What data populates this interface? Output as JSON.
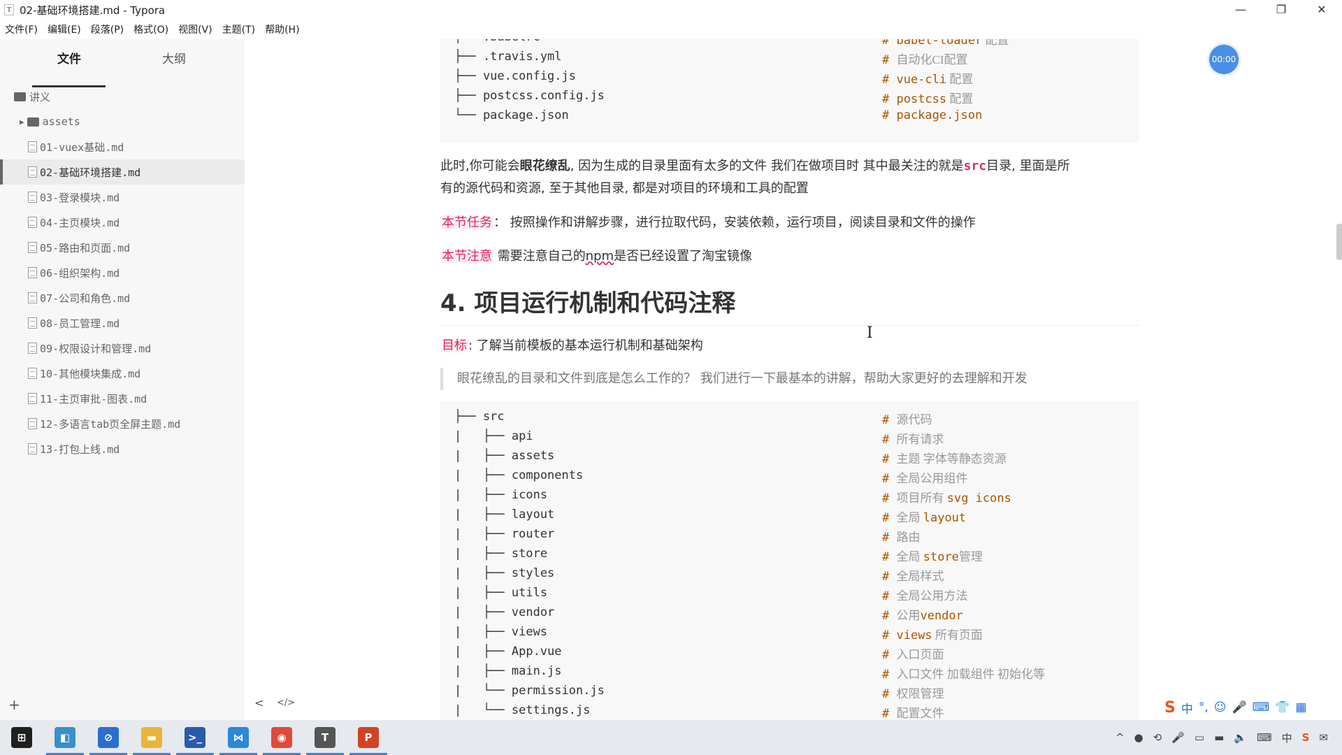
{
  "window": {
    "title": "02-基础环境搭建.md - Typora",
    "app_icon": "T",
    "controls": {
      "minimize": "—",
      "restore": "❐",
      "close": "✕"
    }
  },
  "menu": [
    "文件(F)",
    "编辑(E)",
    "段落(P)",
    "格式(O)",
    "视图(V)",
    "主题(T)",
    "帮助(H)"
  ],
  "sidebar": {
    "tabs": {
      "files": "文件",
      "outline": "大纲"
    },
    "root_folder": "讲义",
    "subfolder": "assets",
    "files": [
      "01-vuex基础.md",
      "02-基础环境搭建.md",
      "03-登录模块.md",
      "04-主页模块.md",
      "05-路由和页面.md",
      "06-组织架构.md",
      "07-公司和角色.md",
      "08-员工管理.md",
      "09-权限设计和管理.md",
      "10-其他模块集成.md",
      "11-主页审批-图表.md",
      "12-多语言tab页全屏主题.md",
      "13-打包上线.md"
    ],
    "active_index": 1,
    "add_button": "+",
    "collapse_button": "<",
    "source_button": "</>"
  },
  "top_code": [
    {
      "tree": "├── .babelrc",
      "kw": "babel-loader",
      "cn": " 配置"
    },
    {
      "tree": "├── .travis.yml",
      "kw": "",
      "cn": "自动化CI配置"
    },
    {
      "tree": "├── vue.config.js",
      "kw": "vue-cli",
      "cn": " 配置"
    },
    {
      "tree": "├── postcss.config.js",
      "kw": "postcss",
      "cn": " 配置"
    },
    {
      "tree": "└── package.json",
      "kw": "package.json",
      "cn": ""
    }
  ],
  "para1": {
    "a": "此时,你可能会",
    "bold": "眼花缭乱",
    "b": ", 因为生成的目录里面有太多的文件 我们在做项目时 其中最关注的就是",
    "code": "src",
    "c": "目录, 里面是所",
    "line2": "有的源代码和资源, 至于其他目录, 都是对项目的环境和工具的配置"
  },
  "task": {
    "tag": "本节任务",
    "text": "：  按照操作和讲解步骤，进行拉取代码，安装依赖，运行项目，阅读目录和文件的操作"
  },
  "note": {
    "tag": "本节注意",
    "text_a": " 需要注意自己的",
    "npm": "npm",
    "text_b": "是否已经设置了淘宝镜像"
  },
  "heading": "4. 项目运行机制和代码注释",
  "goal": {
    "tag": "目标",
    "text": ": 了解当前模板的基本运行机制和基础架构"
  },
  "quote": "眼花缭乱的目录和文件到底是怎么工作的？ 我们进行一下最基本的讲解，帮助大家更好的去理解和开发",
  "src_code": [
    {
      "tree": "├── src",
      "kw": "",
      "cn": "源代码"
    },
    {
      "tree": "|   ├── api",
      "kw": "",
      "cn": "所有请求"
    },
    {
      "tree": "|   ├── assets",
      "kw": "",
      "cn": "主题 字体等静态资源"
    },
    {
      "tree": "|   ├── components",
      "kw": "",
      "cn": "全局公用组件"
    },
    {
      "tree": "|   ├── icons",
      "kw": "",
      "cn": "项目所有 ",
      "kw2": "svg icons"
    },
    {
      "tree": "|   ├── layout",
      "kw": "",
      "cn": "全局 ",
      "kw2": "layout"
    },
    {
      "tree": "|   ├── router",
      "kw": "",
      "cn": "路由"
    },
    {
      "tree": "|   ├── store",
      "kw": "",
      "cn": "全局 ",
      "kw2": "store",
      "cn2": "管理"
    },
    {
      "tree": "|   ├── styles",
      "kw": "",
      "cn": "全局样式"
    },
    {
      "tree": "|   ├── utils",
      "kw": "",
      "cn": "全局公用方法"
    },
    {
      "tree": "|   ├── vendor",
      "kw": "",
      "cn": "公用",
      "kw2": "vendor"
    },
    {
      "tree": "|   ├── views",
      "kw": "views",
      "cn": " 所有页面"
    },
    {
      "tree": "|   ├── App.vue",
      "kw": "",
      "cn": "入口页面"
    },
    {
      "tree": "|   ├── main.js",
      "kw": "",
      "cn": "入口文件 加载组件 初始化等"
    },
    {
      "tree": "|   └── permission.js",
      "kw": "",
      "cn": "权限管理"
    },
    {
      "tree": "|   └── settings.js",
      "kw": "",
      "cn": "配置文件"
    }
  ],
  "timer": "00:00",
  "ime": [
    "中",
    "°,",
    "☺",
    "🎤",
    "⌨",
    "👕",
    "▦"
  ],
  "ime_logo": "S",
  "taskbar": {
    "apps": [
      {
        "name": "windows-start",
        "glyph": "⊞",
        "color": "#1f1f1f",
        "open": false
      },
      {
        "name": "app-1",
        "glyph": "◧",
        "color": "#3b8fc9",
        "open": true
      },
      {
        "name": "app-2",
        "glyph": "⊘",
        "color": "#2a6fcf",
        "open": true
      },
      {
        "name": "file-explorer",
        "glyph": "▬",
        "color": "#e8b43a",
        "open": true
      },
      {
        "name": "powershell",
        "glyph": ">_",
        "color": "#2b5ba8",
        "open": true
      },
      {
        "name": "vscode",
        "glyph": "⋈",
        "color": "#2a88d8",
        "open": true
      },
      {
        "name": "chrome",
        "glyph": "◉",
        "color": "#dd4b39",
        "open": true
      },
      {
        "name": "typora",
        "glyph": "T",
        "color": "#555555",
        "open": true
      },
      {
        "name": "powerpoint",
        "glyph": "P",
        "color": "#d04423",
        "open": true
      }
    ],
    "tray": [
      "^",
      "●",
      "⟲",
      "🎤",
      "▭",
      "▬",
      "🔈",
      "⌨",
      "中",
      "S",
      "✉"
    ]
  }
}
